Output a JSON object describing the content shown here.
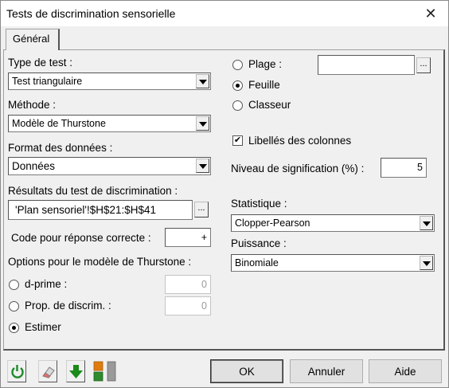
{
  "window": {
    "title": "Tests de discrimination sensorielle"
  },
  "tabs": [
    {
      "label": "Général"
    }
  ],
  "left": {
    "test_type": {
      "label": "Type de test :",
      "value": "Test triangulaire"
    },
    "method": {
      "label": "Méthode :",
      "value": "Modèle de Thurstone"
    },
    "data_format": {
      "label": "Format des données :",
      "value": "Données"
    },
    "results": {
      "label": "Résultats du test de discrimination :",
      "value": "'Plan sensoriel'!$H$21:$H$41",
      "button": "..."
    },
    "correct_code": {
      "label": "Code pour réponse correcte :",
      "value": "+"
    },
    "thurstone": {
      "label": "Options pour le modèle de Thurstone :",
      "options": [
        {
          "label": "d-prime :",
          "value": "0",
          "selected": false
        },
        {
          "label": "Prop. de discrim. :",
          "value": "0",
          "selected": false
        },
        {
          "label": "Estimer",
          "selected": true
        }
      ]
    }
  },
  "right": {
    "output": {
      "options": [
        {
          "label": "Plage :",
          "selected": false
        },
        {
          "label": "Feuille",
          "selected": true
        },
        {
          "label": "Classeur",
          "selected": false
        }
      ],
      "range_button": "..."
    },
    "column_labels": {
      "label": "Libellés des colonnes",
      "checked": true,
      "mark": "✔"
    },
    "significance": {
      "label": "Niveau de signification (%) :",
      "value": "5"
    },
    "statistic": {
      "label": "Statistique :",
      "value": "Clopper-Pearson"
    },
    "power": {
      "label": "Puissance :",
      "value": "Binomiale"
    }
  },
  "footer": {
    "ok": "OK",
    "cancel": "Annuler",
    "help": "Aide",
    "icons": [
      "reset-icon",
      "eraser-icon",
      "download-icon",
      "layout-icon"
    ],
    "colors": {
      "reset": "#1c8a2a",
      "download": "#1a8a1a",
      "layout_top": "#e07b10",
      "layout_bottom": "#2e8b2e"
    }
  }
}
